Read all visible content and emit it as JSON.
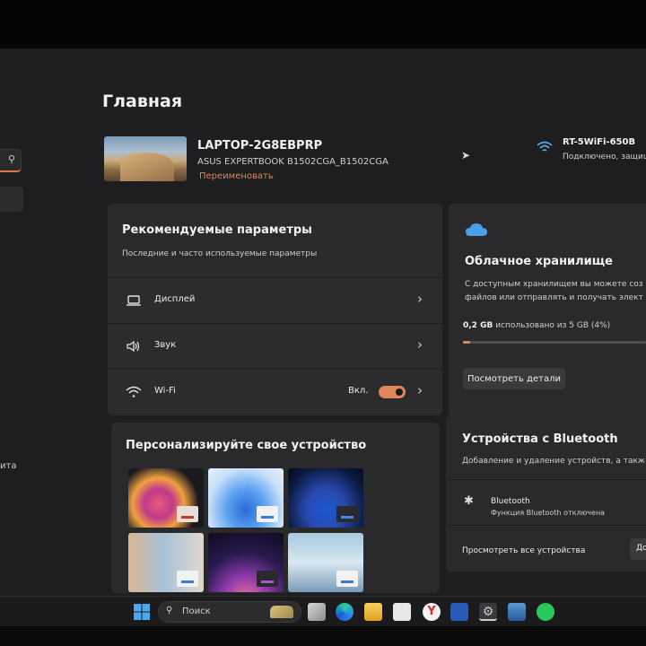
{
  "page": {
    "title": "Главная"
  },
  "device": {
    "name": "LAPTOP-2G8EBPRP",
    "model": "ASUS EXPERTBOOK B1502CGA_B1502CGA",
    "rename_label": "Переименовать"
  },
  "network": {
    "name": "RT-5WiFi-650B",
    "status": "Подключено, защищ"
  },
  "sidebar": {
    "fragment": "ита"
  },
  "recommended": {
    "title": "Рекомендуемые параметры",
    "subtitle": "Последние и часто используемые параметры",
    "items": [
      {
        "label": "Дисплей",
        "icon": "laptop-icon"
      },
      {
        "label": "Звук",
        "icon": "speaker-icon"
      },
      {
        "label": "Wi-Fi",
        "icon": "wifi-icon",
        "toggle_label": "Вкл.",
        "toggle_on": true
      }
    ]
  },
  "cloud": {
    "title": "Облачное хранилище",
    "desc_line1": "С доступным хранилищем вы можете соз",
    "desc_line2": "файлов или отправлять и получать элект",
    "usage_value": "0,2 GB",
    "usage_text": " использовано из 5 GB (4%)",
    "usage_percent": 4,
    "details_button": "Посмотреть детали"
  },
  "personalize": {
    "title": "Персонализируйте свое устройство"
  },
  "bluetooth": {
    "title": "Устройства с Bluetooth",
    "subtitle": "Добавление и удаление устройств, а такж",
    "device_name": "Bluetooth",
    "device_status": "Функция Bluetooth отключена",
    "view_all": "Просмотреть все устройства",
    "add_fragment": "До"
  },
  "taskbar": {
    "search_label": "Поиск"
  },
  "colors": {
    "accent": "#e0875a",
    "card": "#2a2a2c",
    "background": "#1e1e20"
  }
}
